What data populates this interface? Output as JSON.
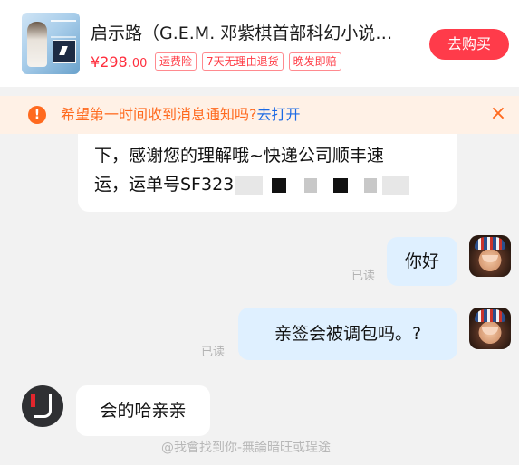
{
  "product": {
    "title": "启示路（G.E.M. 邓紫棋首部科幻小说…",
    "price_main": "¥298.",
    "price_cents": "00",
    "tags": [
      "运费险",
      "7天无理由退货",
      "晚发即赔"
    ],
    "buy_label": "去购买"
  },
  "notify": {
    "text": "希望第一时间收到消息通知吗?",
    "link": "去打开",
    "close": "×",
    "icon_glyph": "!"
  },
  "messages": {
    "m1_line1": "下，感谢您的理解哦~快递公司顺丰速",
    "m1_line2": "运，运单号SF323",
    "m2": "你好",
    "m3": "亲签会被调包吗。?",
    "m4": "会的哈亲亲",
    "read_label": "已读"
  },
  "watermark": "@我會找到你-無論暗旺或珵途",
  "colors": {
    "accent": "#ff3b4a",
    "price": "#ff2e3d",
    "banner_bg": "#fff1e6",
    "banner_text": "#ff6a1f",
    "link": "#1c6ae4",
    "outgoing_bubble": "#dff0ff"
  },
  "icons": {
    "warning": "warning-icon",
    "close": "close-icon"
  }
}
